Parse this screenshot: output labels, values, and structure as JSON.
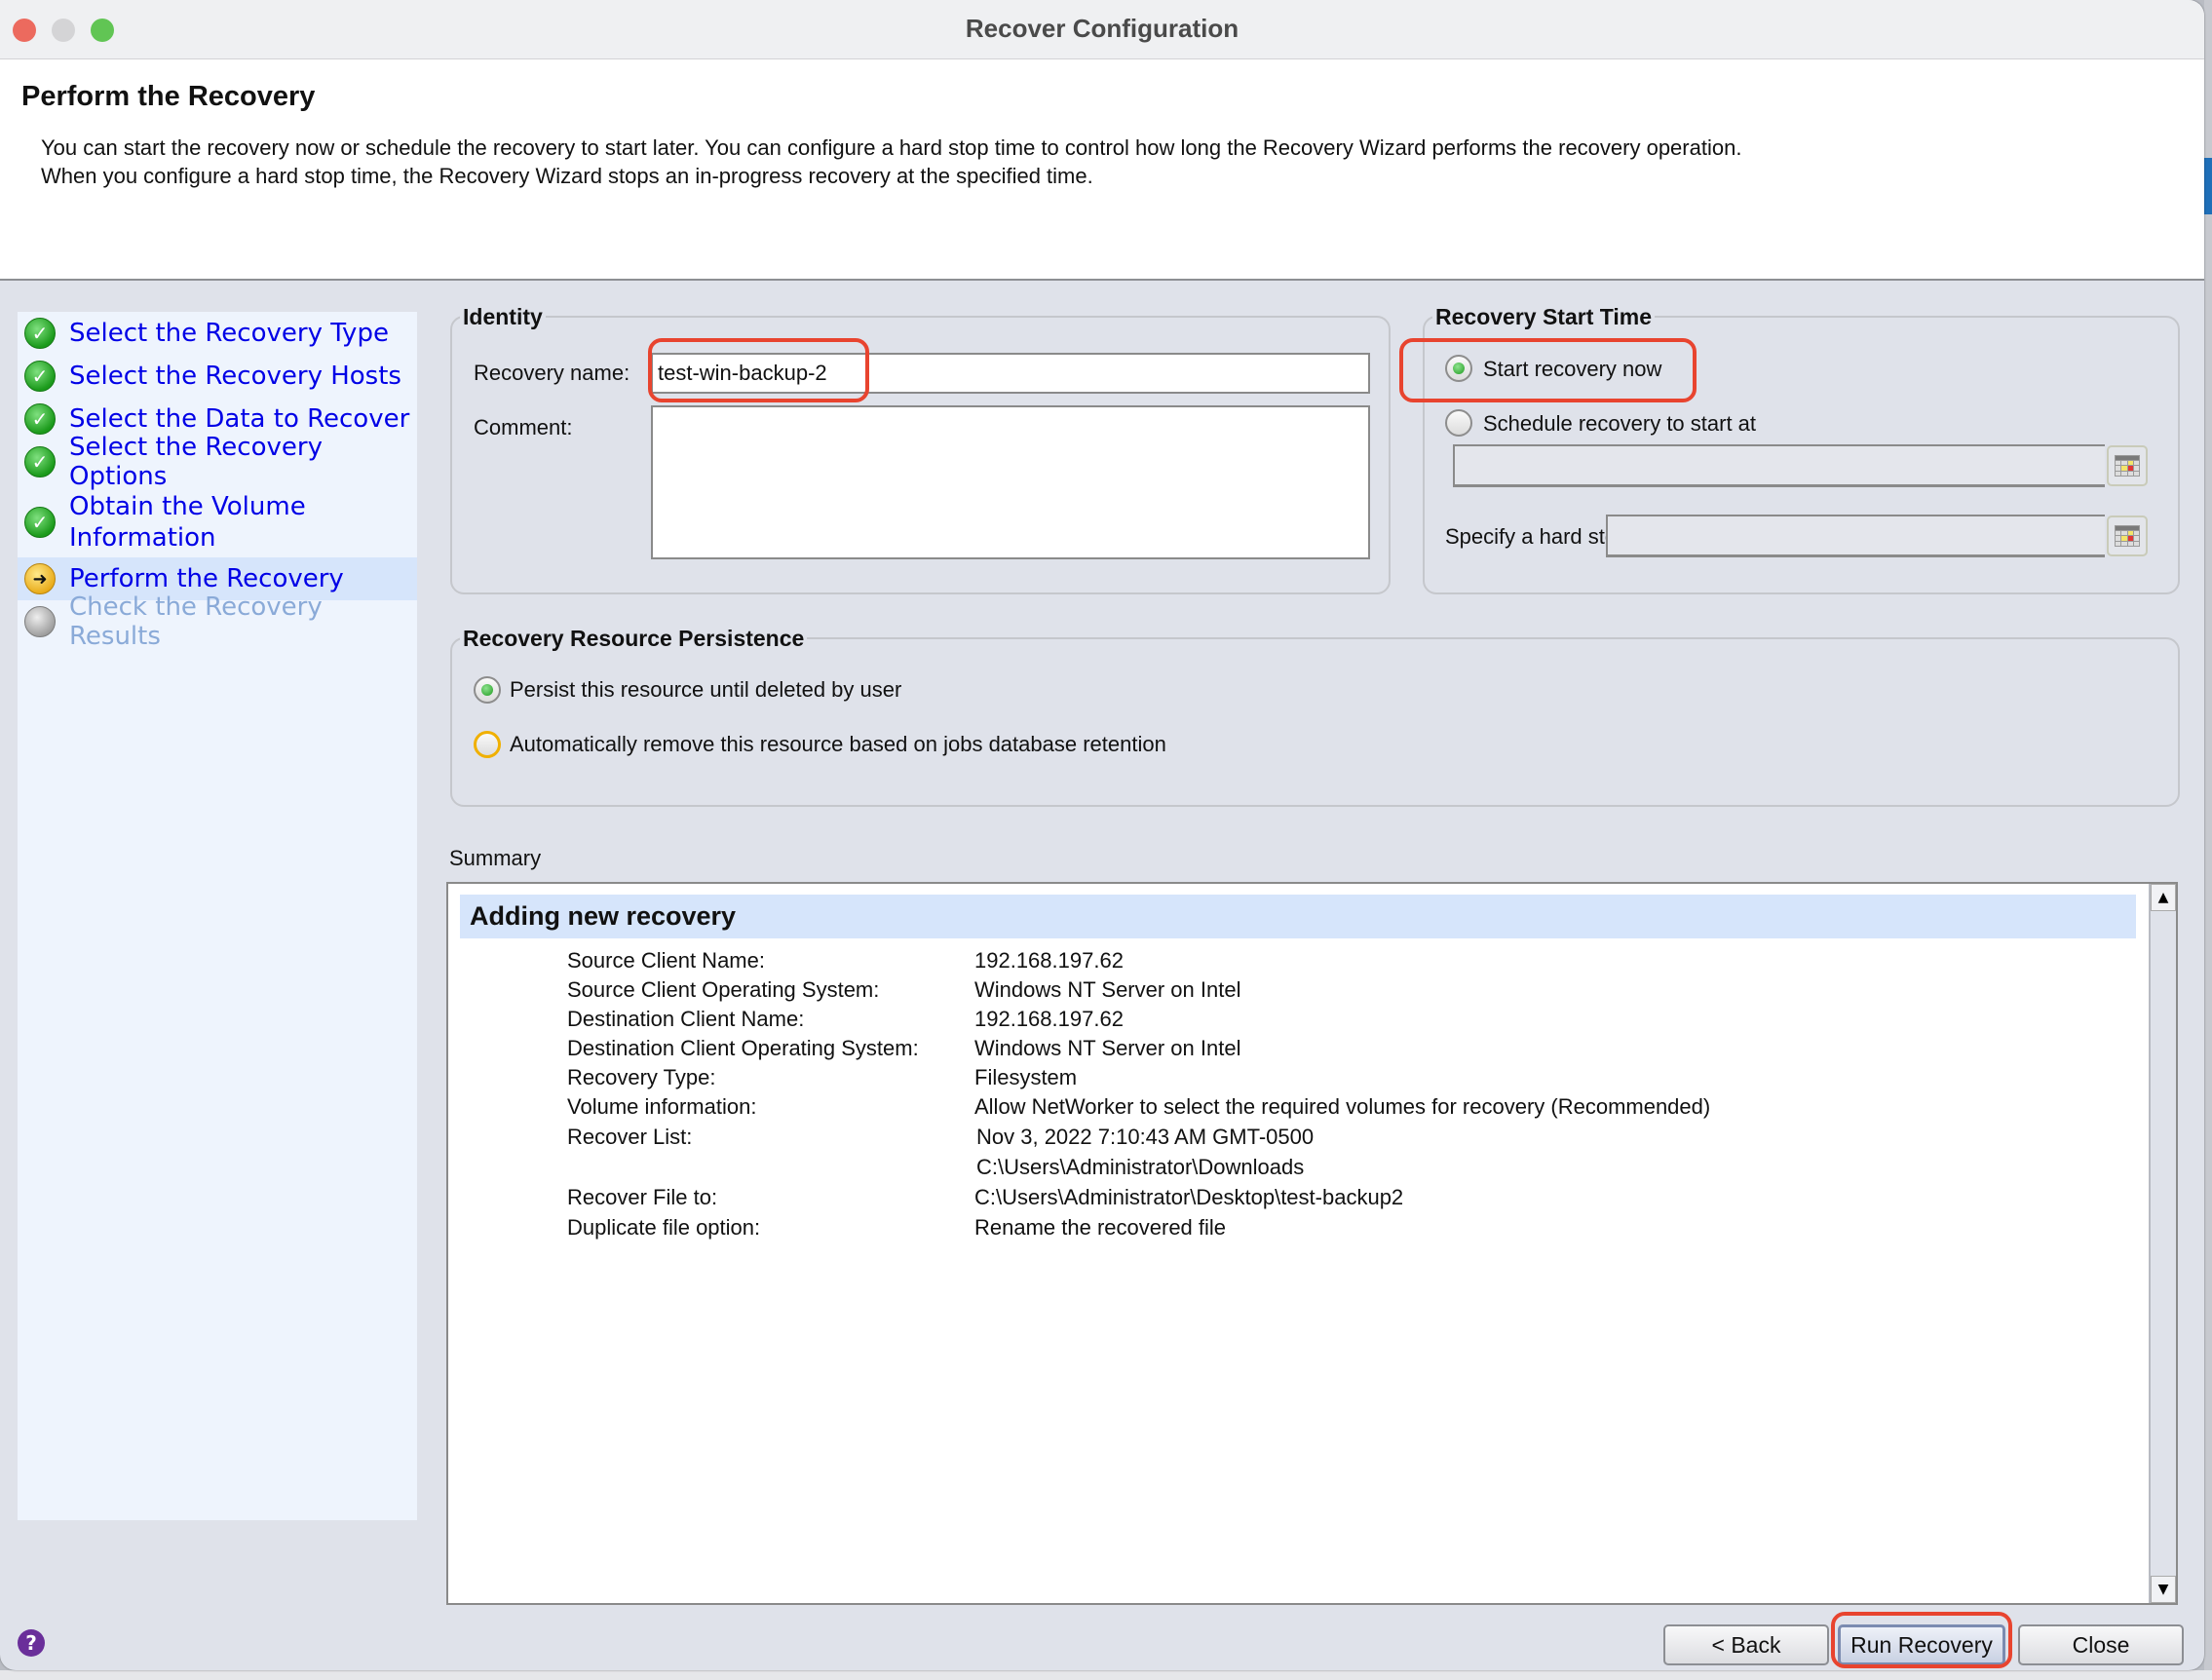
{
  "window": {
    "title": "Recover Configuration"
  },
  "header": {
    "title": "Perform the Recovery",
    "description": "You can start the recovery now or schedule the recovery to start later.  You can configure a hard stop time to control how long the Recovery Wizard performs the recovery operation.\nWhen you configure a hard stop time, the Recovery Wizard stops an in-progress recovery at the specified time."
  },
  "sidebar": {
    "steps": [
      {
        "label": "Select the Recovery Type",
        "status": "done",
        "icon": "check-circle-icon"
      },
      {
        "label": "Select the Recovery Hosts",
        "status": "done",
        "icon": "check-circle-icon"
      },
      {
        "label": "Select the Data to Recover",
        "status": "done",
        "icon": "check-circle-icon"
      },
      {
        "label": "Select the Recovery Options",
        "status": "done",
        "icon": "check-circle-icon"
      },
      {
        "label": "Obtain the Volume Information",
        "status": "done",
        "icon": "check-circle-icon"
      },
      {
        "label": "Perform the Recovery",
        "status": "current",
        "icon": "arrow-circle-icon"
      },
      {
        "label": "Check the Recovery Results",
        "status": "pending",
        "icon": "gray-circle-icon"
      }
    ]
  },
  "identity": {
    "title": "Identity",
    "recovery_name_label": "Recovery name:",
    "recovery_name_value": "test-win-backup-2",
    "comment_label": "Comment:",
    "comment_value": ""
  },
  "start_time": {
    "title": "Recovery Start Time",
    "options": [
      {
        "label": "Start recovery now",
        "selected": true
      },
      {
        "label": "Schedule recovery to start at",
        "selected": false
      }
    ],
    "schedule_value": "",
    "hard_stop_label": "Specify a hard stop time:",
    "hard_stop_value": ""
  },
  "persistence": {
    "title": "Recovery Resource Persistence",
    "options": [
      {
        "label": "Persist this resource until deleted by user",
        "selected": true
      },
      {
        "label": "Automatically remove this resource based on jobs database retention",
        "selected": false
      }
    ]
  },
  "summary": {
    "label": "Summary",
    "heading": "Adding new recovery",
    "rows": [
      {
        "key": "Source Client Name:",
        "value": "192.168.197.62"
      },
      {
        "key": "Source Client Operating System:",
        "value": "Windows NT Server on Intel"
      },
      {
        "key": "Destination Client Name:",
        "value": "192.168.197.62"
      },
      {
        "key": "Destination Client Operating System:",
        "value": "Windows NT Server on Intel"
      },
      {
        "key": "Recovery Type:",
        "value": "Filesystem"
      },
      {
        "key": "Volume information:",
        "value": "Allow NetWorker to select the required volumes for recovery (Recommended)"
      },
      {
        "key": "Recover List:",
        "value": "Nov 3, 2022 7:10:43 AM GMT-0500"
      },
      {
        "key": "",
        "value": "C:\\Users\\Administrator\\Downloads"
      },
      {
        "key": "Recover File to:",
        "value": "C:\\Users\\Administrator\\Desktop\\test-backup2"
      },
      {
        "key": "Duplicate file option:",
        "value": "Rename the recovered file"
      }
    ]
  },
  "buttons": {
    "back": "< Back",
    "run": "Run Recovery",
    "close": "Close",
    "help_glyph": "?"
  },
  "colors": {
    "link_blue": "#0000e6",
    "annotation_red": "#e8442f",
    "current_step_bg": "#d6e5fb"
  }
}
